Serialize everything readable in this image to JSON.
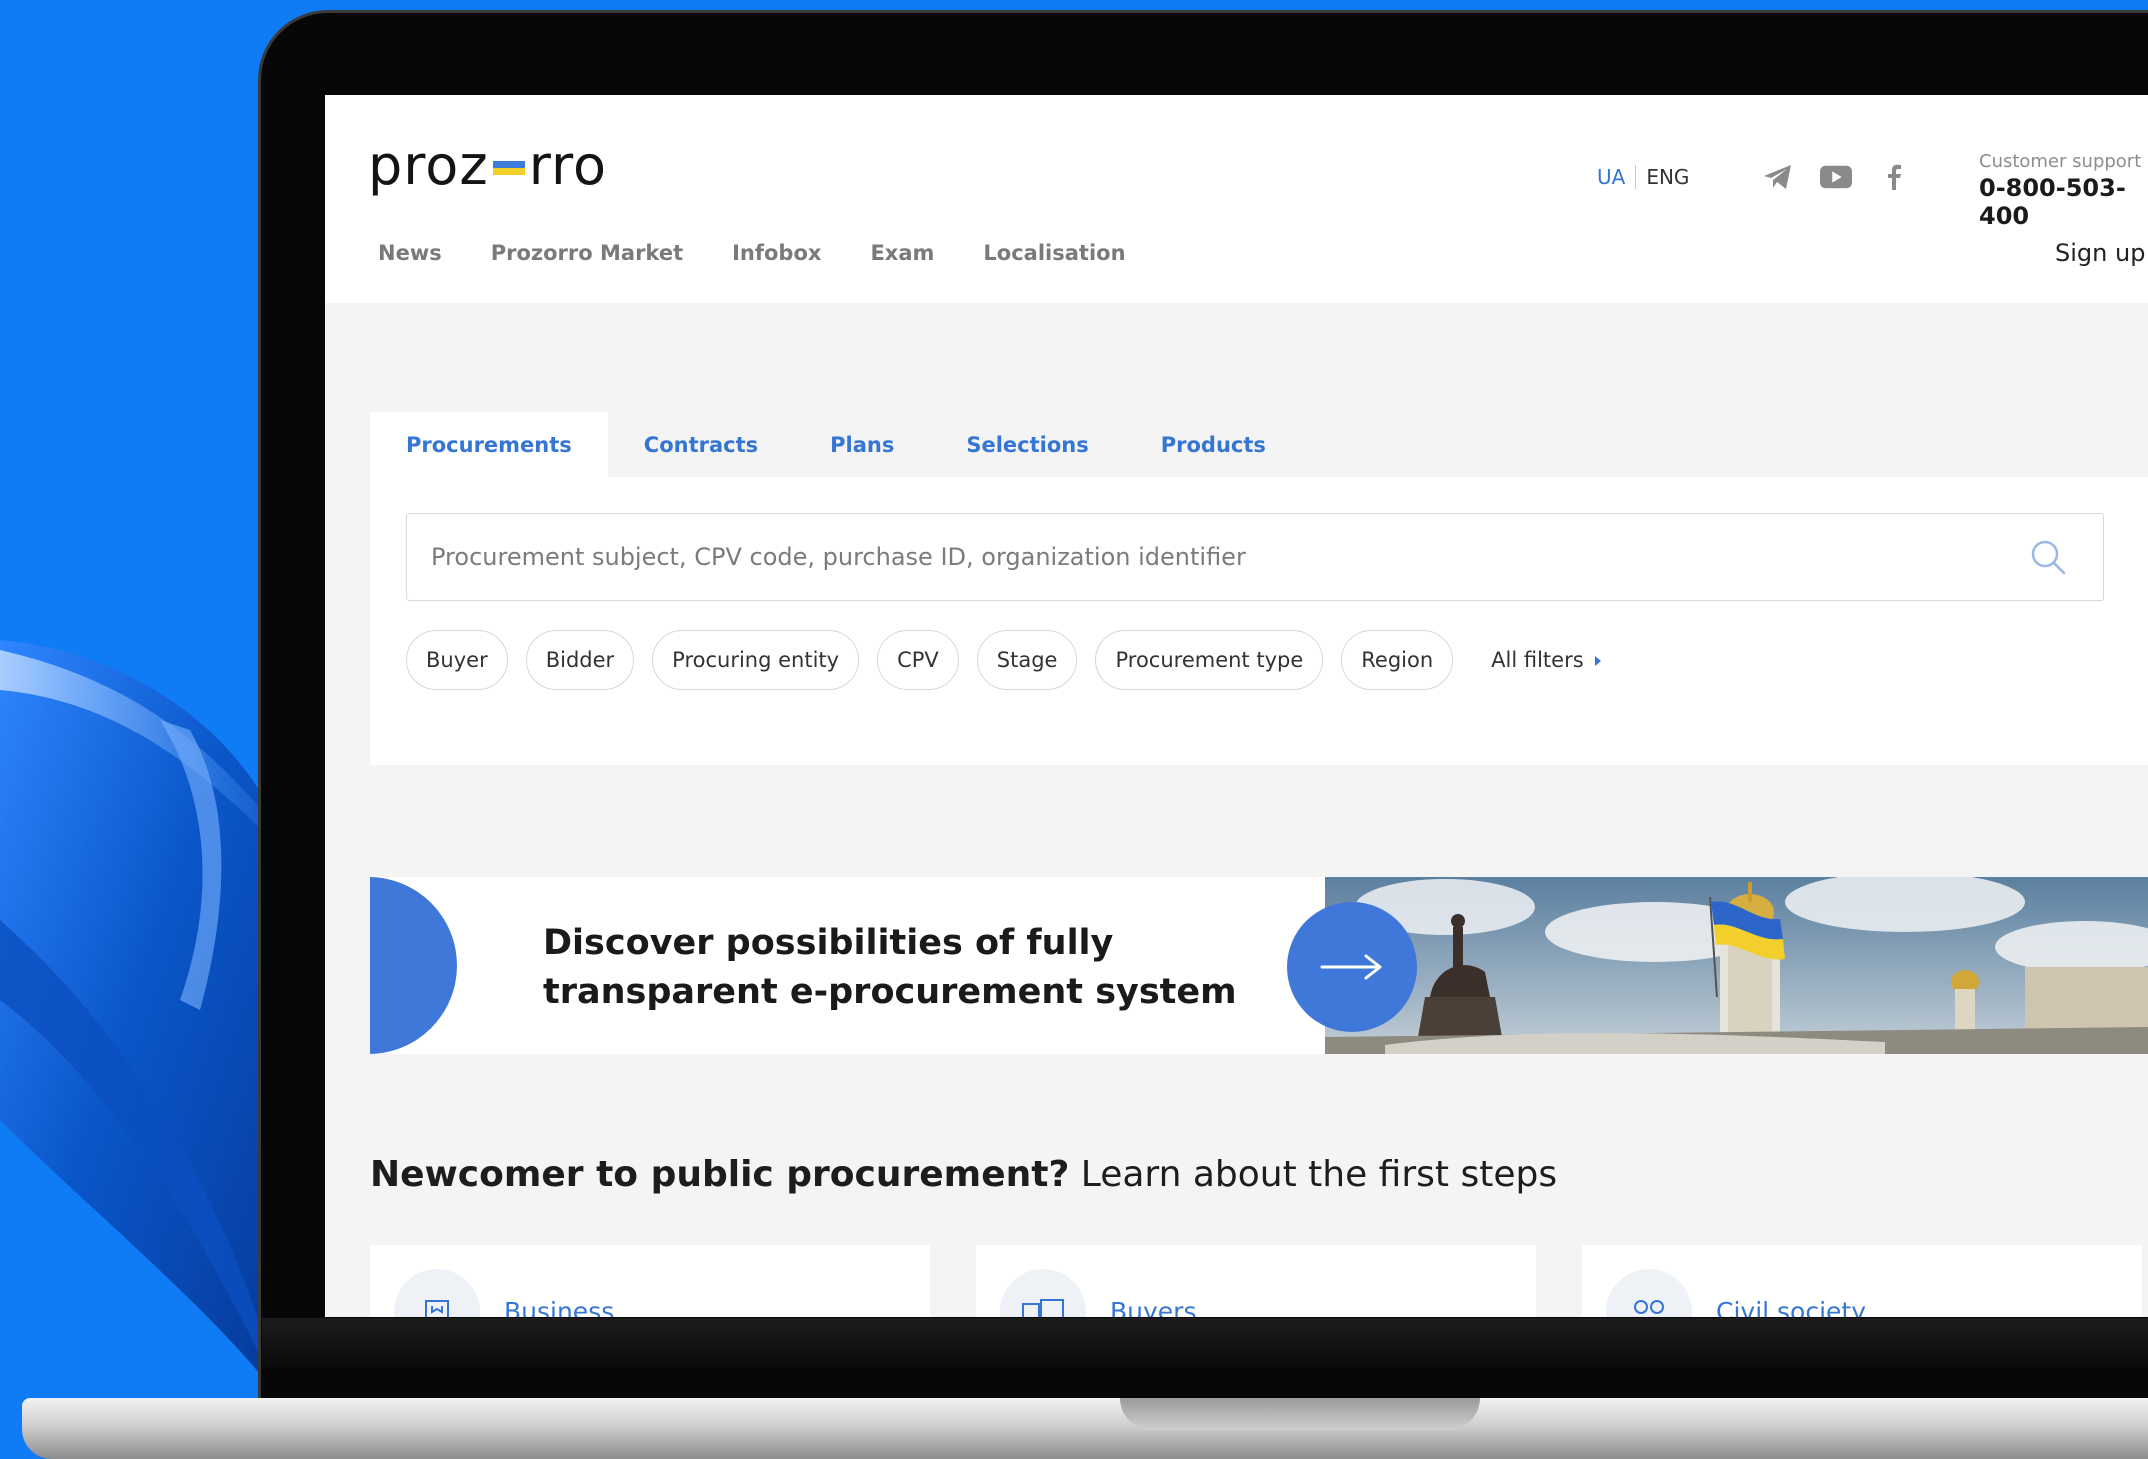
{
  "brand": {
    "name_left": "proz",
    "name_right": "rro",
    "flag_colors": [
      "#3c7dd9",
      "#f4d12a"
    ]
  },
  "header": {
    "languages": {
      "ua": "UA",
      "en": "ENG",
      "active": "UA"
    },
    "social_icons": [
      "telegram-icon",
      "youtube-icon",
      "facebook-icon"
    ],
    "support_label": "Customer support",
    "support_phone": "0-800-503-400",
    "signup_label": "Sign up"
  },
  "nav": {
    "items": [
      "News",
      "Prozorro Market",
      "Infobox",
      "Exam",
      "Localisation"
    ]
  },
  "search": {
    "tabs": [
      "Procurements",
      "Contracts",
      "Plans",
      "Selections",
      "Products"
    ],
    "active_tab": "Procurements",
    "placeholder": "Procurement subject, CPV code, purchase ID, organization identifier",
    "value": "",
    "filters": [
      "Buyer",
      "Bidder",
      "Procuring entity",
      "CPV",
      "Stage",
      "Procurement type",
      "Region"
    ],
    "all_filters_label": "All filters"
  },
  "banner": {
    "line1": "Discover possibilities of fully",
    "line2": "transparent e-procurement system"
  },
  "newcomer": {
    "bold": "Newcomer to public procurement?",
    "rest": " Learn about the first steps",
    "cards": [
      "Business",
      "Buyers",
      "Civil society"
    ]
  },
  "colors": {
    "accent": "#3575d3",
    "background": "#0f7bf5",
    "banner_blue": "#3f78d9"
  }
}
